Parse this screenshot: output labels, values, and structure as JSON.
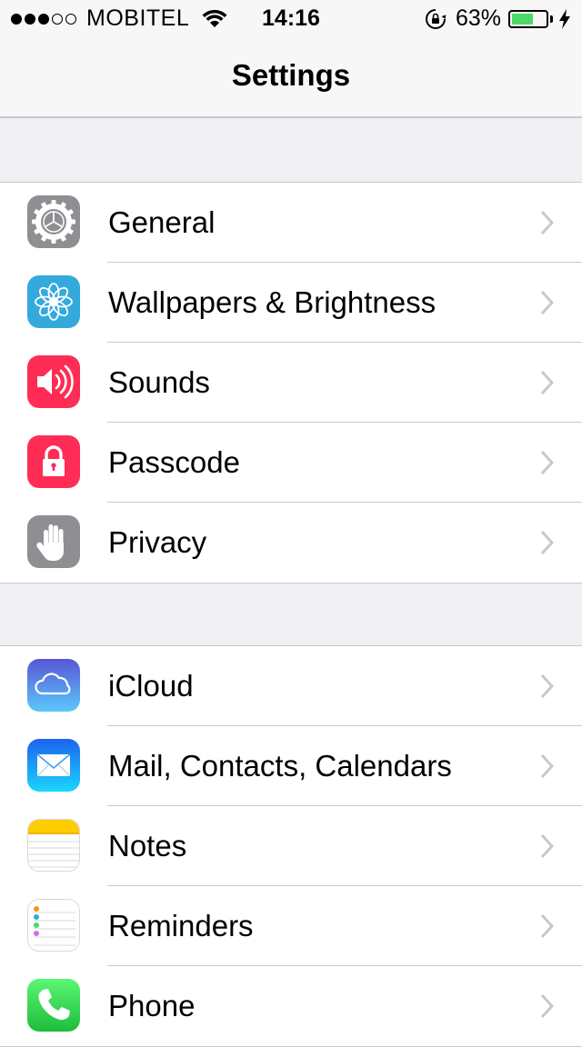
{
  "status_bar": {
    "carrier": "MOBITEL",
    "time": "14:16",
    "battery_percent": "63%",
    "battery_level": 0.63,
    "signal_bars_filled": 3,
    "signal_bars_total": 5
  },
  "nav": {
    "title": "Settings"
  },
  "groups": [
    {
      "items": [
        {
          "label": "General",
          "icon": "gear-icon",
          "color": "#8e8e93"
        },
        {
          "label": "Wallpapers & Brightness",
          "icon": "flower-icon",
          "color": "#34aadc"
        },
        {
          "label": "Sounds",
          "icon": "speaker-icon",
          "color": "#ff2d55"
        },
        {
          "label": "Passcode",
          "icon": "lock-icon",
          "color": "#ff2d55"
        },
        {
          "label": "Privacy",
          "icon": "hand-icon",
          "color": "#8e8e93"
        }
      ]
    },
    {
      "items": [
        {
          "label": "iCloud",
          "icon": "cloud-icon",
          "color": "#5856d6"
        },
        {
          "label": "Mail, Contacts, Calendars",
          "icon": "envelope-icon",
          "color": "#1d77ef"
        },
        {
          "label": "Notes",
          "icon": "notepad-icon",
          "color": "#ffcc00"
        },
        {
          "label": "Reminders",
          "icon": "checklist-icon",
          "color": "#ffffff"
        },
        {
          "label": "Phone",
          "icon": "phone-icon",
          "color": "#4cd964"
        }
      ]
    }
  ],
  "colors": {
    "accent_green": "#4cd964",
    "separator": "#c8c7cc",
    "background": "#efeff4"
  }
}
